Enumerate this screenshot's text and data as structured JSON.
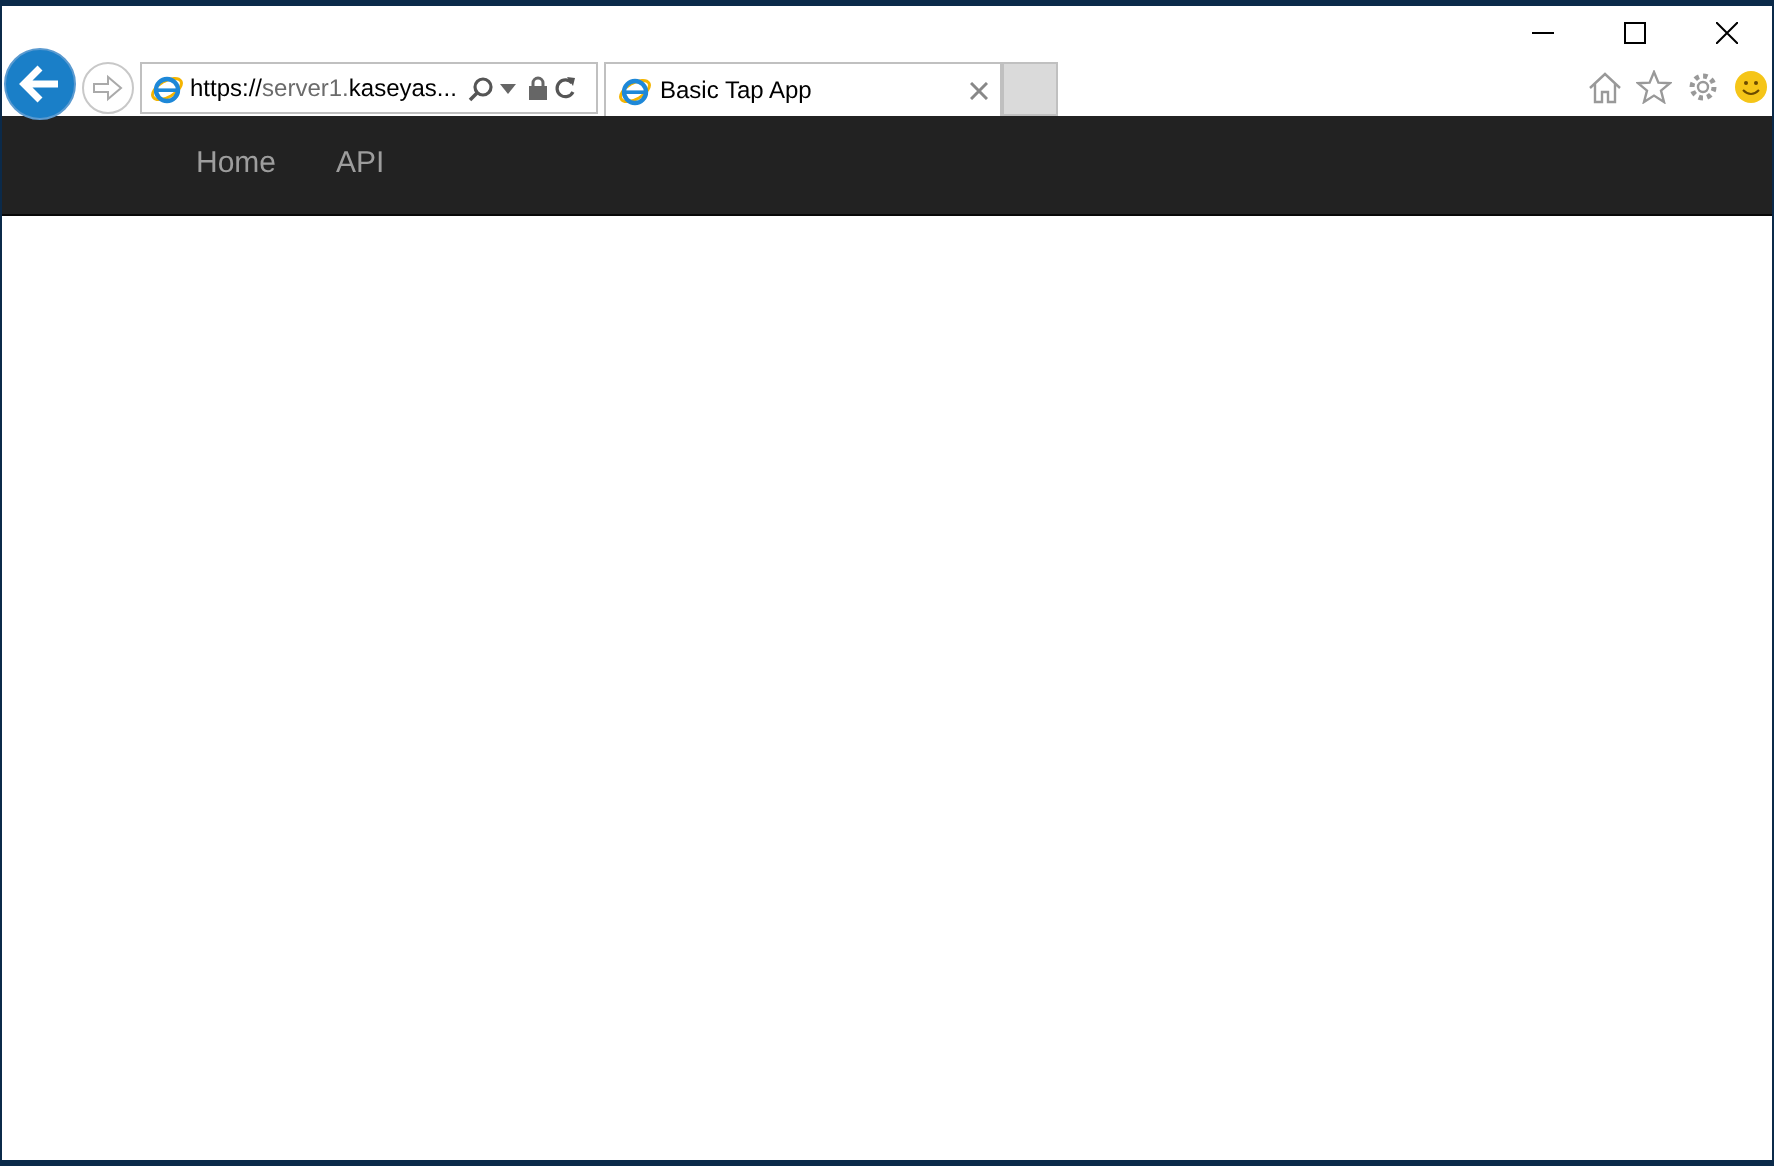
{
  "address_bar": {
    "url": [
      {
        "text": "https://",
        "dim": false
      },
      {
        "text": "server1.",
        "dim": true
      },
      {
        "text": "kaseyas...",
        "dim": false
      }
    ]
  },
  "tabs": [
    {
      "label": "Basic Tap App",
      "selected": true
    }
  ],
  "navbar": {
    "links": [
      "Home",
      "API"
    ]
  }
}
